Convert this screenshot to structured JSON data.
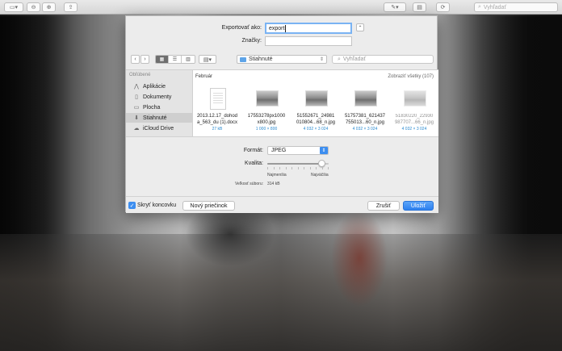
{
  "toolbar": {
    "search_placeholder": "Vyhľadať"
  },
  "dialog": {
    "export_as_label": "Exportovať ako:",
    "export_as_value": "export",
    "tags_label": "Značky:",
    "tags_value": "",
    "location": "Stiahnuté",
    "search_placeholder": "Vyhľadať",
    "sidebar": {
      "heading": "Obľúbené",
      "items": [
        {
          "label": "Aplikácie",
          "icon": "applications-icon",
          "selected": false
        },
        {
          "label": "Dokumenty",
          "icon": "documents-icon",
          "selected": false
        },
        {
          "label": "Plocha",
          "icon": "desktop-icon",
          "selected": false
        },
        {
          "label": "Stiahnuté",
          "icon": "downloads-icon",
          "selected": true
        },
        {
          "label": "iCloud Drive",
          "icon": "cloud-icon",
          "selected": false
        }
      ]
    },
    "files_section": "Február",
    "show_all": "Zobraziť všetky (107)",
    "files": [
      {
        "name1": "2013.12.17_dohod",
        "name2": "a_563_du (1).docx",
        "meta": "27 kB",
        "kind": "doc"
      },
      {
        "name1": "17553278px1000",
        "name2": "x800.jpg",
        "meta": "1 000 × 800",
        "kind": "photo"
      },
      {
        "name1": "51552671_24981",
        "name2": "010804...68_n.jpg",
        "meta": "4 032 × 3 024",
        "kind": "photo"
      },
      {
        "name1": "51757381_621437",
        "name2": "755013...60_n.jpg",
        "meta": "4 032 × 3 024",
        "kind": "photo"
      },
      {
        "name1": "51830220_22930",
        "name2": "987707...66_n.jpg",
        "meta": "4 032 × 3 024",
        "kind": "photo"
      }
    ],
    "format_label": "Formát:",
    "format_value": "JPEG",
    "quality_label": "Kvalita:",
    "quality_level": 0.88,
    "quality_min": "Najmenšia",
    "quality_max": "Najväčšia",
    "filesize_label": "Veľkosť súboru:",
    "filesize_value": "314 kB",
    "hide_extension_label": "Skryť koncovku",
    "hide_extension_checked": true,
    "new_folder_label": "Nový priečinok",
    "cancel_label": "Zrušiť",
    "save_label": "Uložiť"
  }
}
